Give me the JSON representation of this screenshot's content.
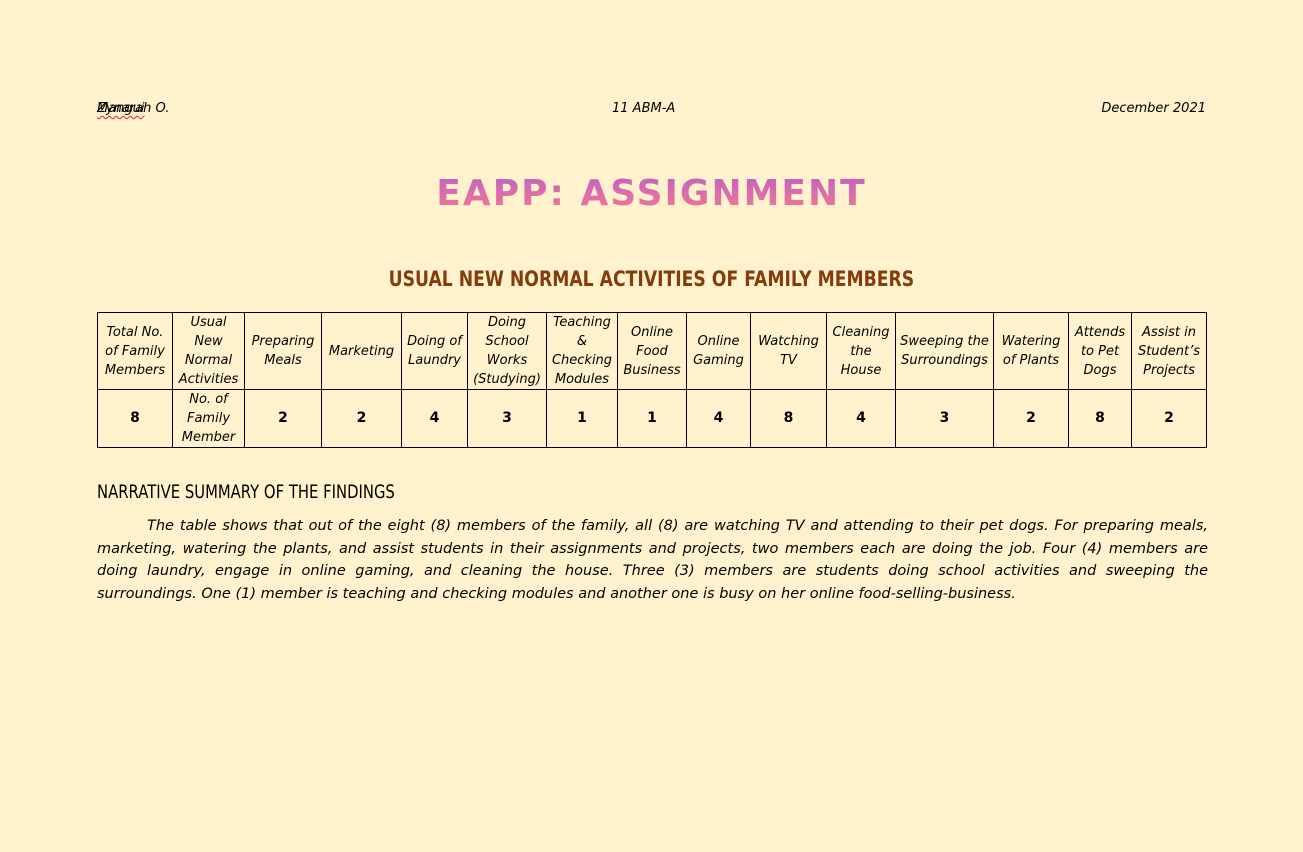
{
  "header": {
    "name": "Zynarah O. Mangui",
    "name_first": "Zynarah O. ",
    "name_last": "Mangui",
    "section": "11 ABM-A",
    "date": "December 2021"
  },
  "document_title": "EAPP: ASSIGNMENT",
  "table_title": "USUAL NEW NORMAL ACTIVITIES OF FAMILY MEMBERS",
  "table": {
    "headers": [
      "Total No. of Family Members",
      "Usual New Normal Activities",
      "Preparing Meals",
      "Marketing",
      "Doing of Laundry",
      "Doing School Works (Studying)",
      "Teaching & Checking Modules",
      "Online Food Business",
      "Online Gaming",
      "Watching TV",
      "Cleaning the House",
      "Sweeping the Surroundings",
      "Watering of Plants",
      "Attends to Pet Dogs",
      "Assist in Student’s Projects"
    ],
    "values": [
      "8",
      "No. of Family Member",
      "2",
      "2",
      "4",
      "3",
      "1",
      "1",
      "4",
      "8",
      "4",
      "3",
      "2",
      "8",
      "2"
    ]
  },
  "summary": {
    "heading": "NARRATIVE SUMMARY OF THE FINDINGS",
    "text": "The table shows that out of the eight (8) members of the family, all (8) are watching TV and attending to their pet dogs. For preparing meals, marketing, watering the plants, and assist students in their assignments and projects, two members each are doing the job. Four (4) members are doing laundry, engage in online gaming, and cleaning the house. Three (3) members are students doing school activities and sweeping the surroundings. One (1) member is teaching and checking modules and another one is busy on her online food-selling-business."
  }
}
